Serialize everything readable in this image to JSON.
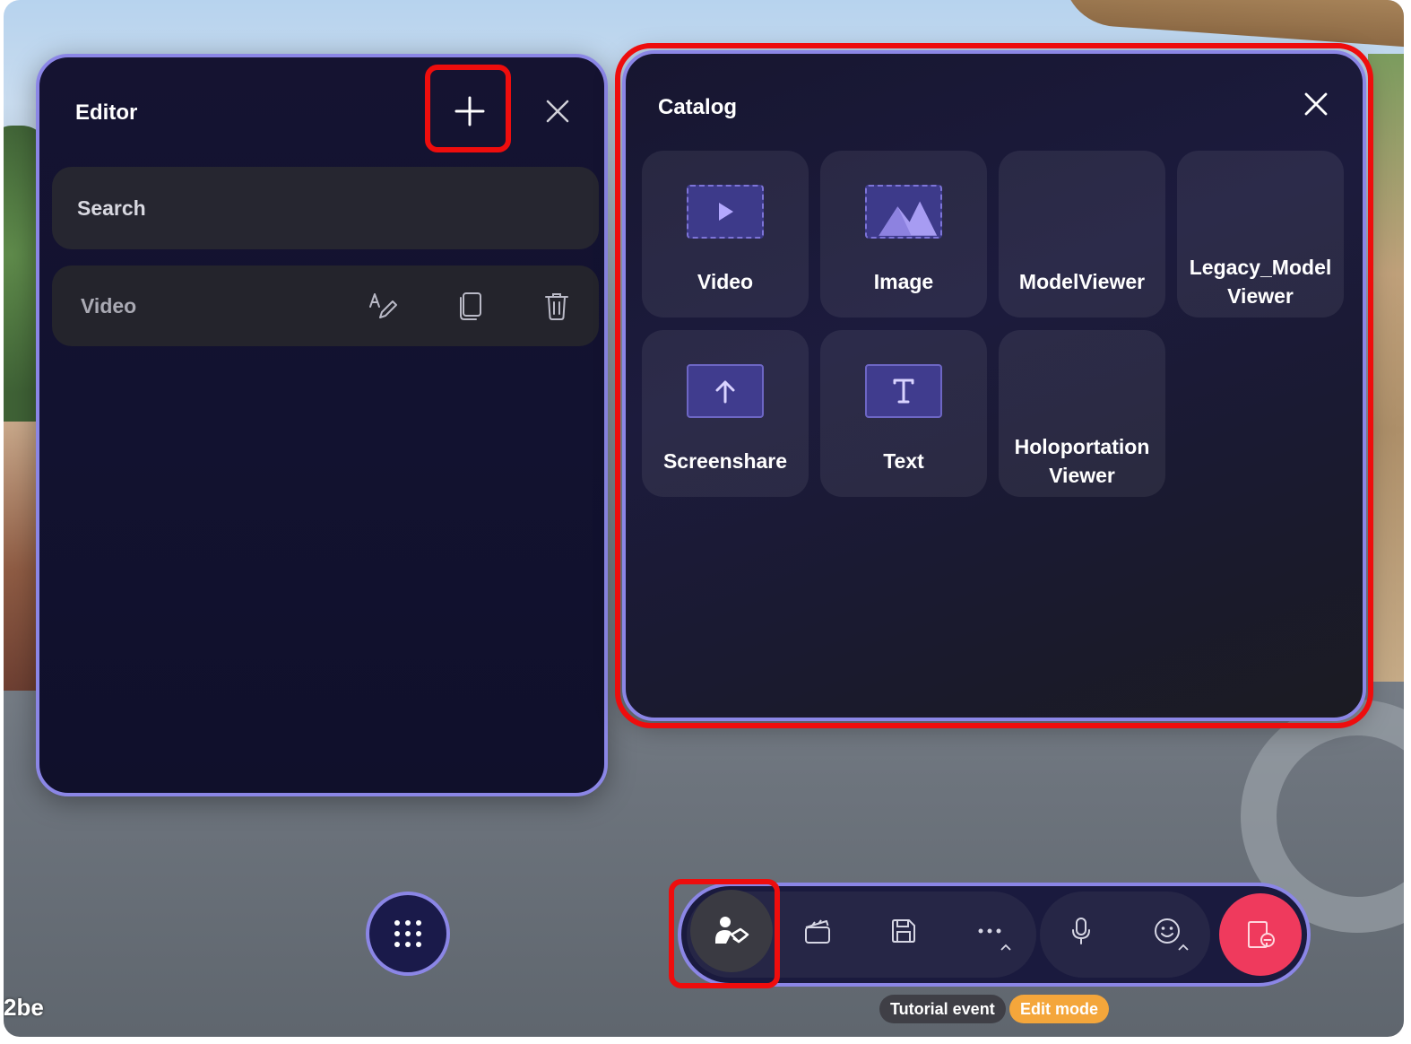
{
  "scene": {
    "corner_text": "2be"
  },
  "editor": {
    "title": "Editor",
    "search_placeholder": "Search",
    "items": [
      {
        "label": "Video"
      }
    ]
  },
  "catalog": {
    "title": "Catalog",
    "tiles": [
      {
        "label": "Video",
        "icon": "video-play-icon"
      },
      {
        "label": "Image",
        "icon": "image-mountains-icon"
      },
      {
        "label": "ModelViewer",
        "icon": ""
      },
      {
        "label": "Legacy_Model\nViewer",
        "line1": "Legacy_Model",
        "line2": "Viewer",
        "icon": ""
      },
      {
        "label": "Screenshare",
        "icon": "upload-arrow-icon"
      },
      {
        "label": "Text",
        "icon": "text-t-icon"
      },
      {
        "label": "Holoportation\nViewer",
        "line1": "Holoportation",
        "line2": "Viewer",
        "icon": ""
      }
    ]
  },
  "toolbar": {
    "buttons": [
      "host-tools",
      "clapperboard",
      "save",
      "more",
      "microphone",
      "reactions",
      "leave"
    ]
  },
  "status": {
    "event_name": "Tutorial event",
    "mode": "Edit mode"
  },
  "colors": {
    "accent_border": "#8b86e6",
    "highlight": "#ee0d0d",
    "leave": "#ef3a5d",
    "edit_mode_chip": "#f4a63b"
  }
}
